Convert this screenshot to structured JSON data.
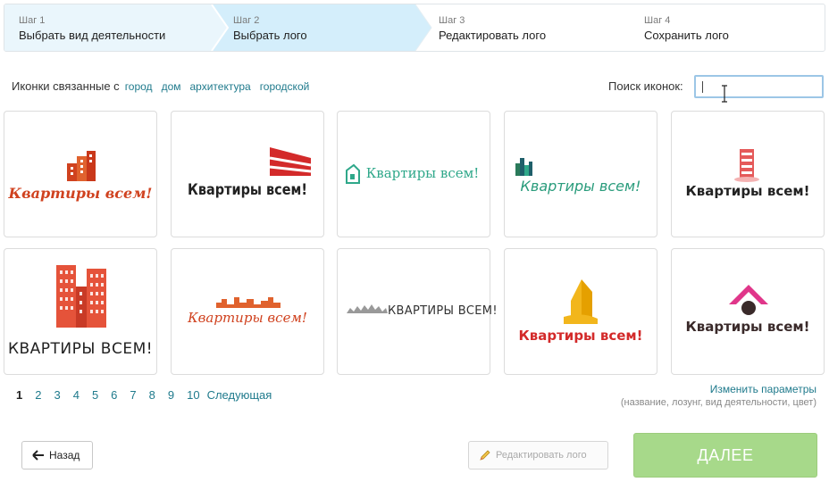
{
  "steps": [
    {
      "num": "Шаг 1",
      "title": "Выбрать вид деятельности"
    },
    {
      "num": "Шаг 2",
      "title": "Выбрать лого"
    },
    {
      "num": "Шаг 3",
      "title": "Редактировать лого"
    },
    {
      "num": "Шаг 4",
      "title": "Сохранить лого"
    }
  ],
  "related": {
    "label": "Иконки связанные с",
    "tags": [
      "город",
      "дом",
      "архитектура",
      "городской"
    ]
  },
  "search": {
    "label": "Поиск иконок:",
    "value": ""
  },
  "logos": [
    {
      "caption": "Квартиры всем!"
    },
    {
      "caption": "Квартиры всем!"
    },
    {
      "caption": "Квартиры всем!"
    },
    {
      "caption": "Квартиры всем!"
    },
    {
      "caption": "Квартиры всем!"
    },
    {
      "caption": "КВАРТИРЫ ВСЕМ!"
    },
    {
      "caption": "Квартиры всем!"
    },
    {
      "caption": "КВАРТИРЫ ВСЕМ!"
    },
    {
      "caption": "Квартиры всем!"
    },
    {
      "caption": "Квартиры всем!"
    }
  ],
  "pager": {
    "pages": [
      "1",
      "2",
      "3",
      "4",
      "5",
      "6",
      "7",
      "8",
      "9",
      "10"
    ],
    "active": "1",
    "next": "Следующая"
  },
  "params": {
    "link": "Изменить параметры",
    "hint": "(название, лозунг, вид деятельности, цвет)"
  },
  "buttons": {
    "back": "Назад",
    "edit": "Редактировать лого",
    "next": "ДАЛЕЕ"
  },
  "colors": {
    "active_step": "#d4eefb",
    "link": "#1f7a8c",
    "next_button": "#a7d98a"
  }
}
